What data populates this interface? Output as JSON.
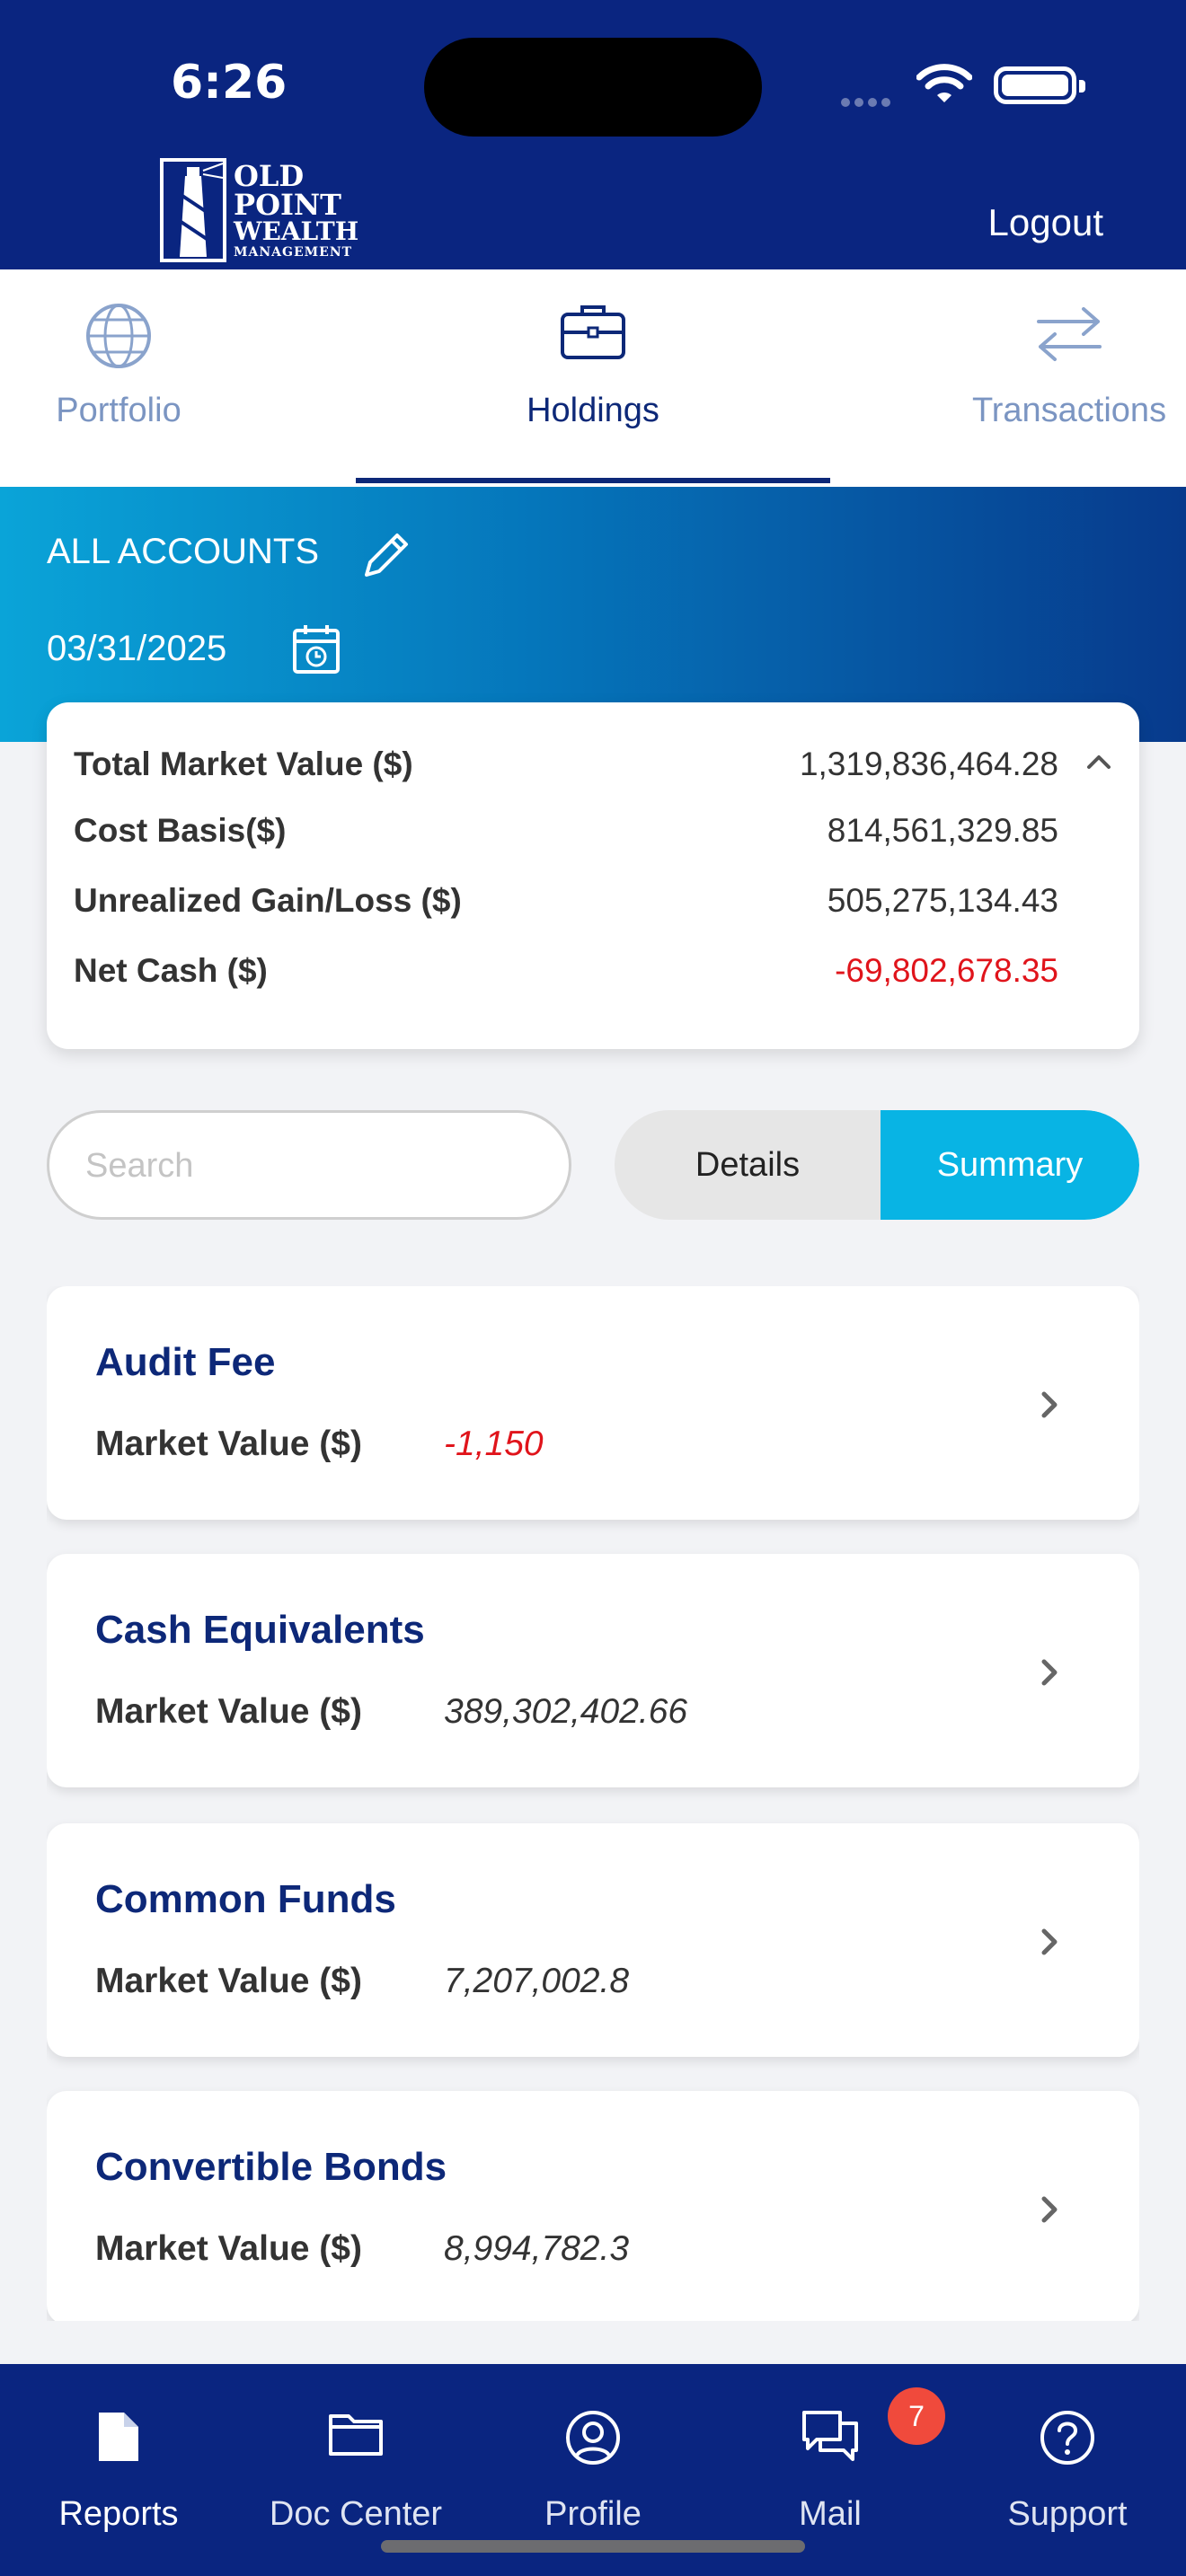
{
  "status_bar": {
    "time": "6:26"
  },
  "header": {
    "logo_lines": [
      "OLD",
      "POINT",
      "WEALTH",
      "MANAGEMENT"
    ],
    "logout_label": "Logout"
  },
  "tabs": [
    {
      "label": "Portfolio",
      "icon": "globe-icon",
      "active": false
    },
    {
      "label": "Holdings",
      "icon": "briefcase-icon",
      "active": true
    },
    {
      "label": "Transactions",
      "icon": "transfer-arrows-icon",
      "active": false
    }
  ],
  "account": {
    "name": "ALL ACCOUNTS",
    "date": "03/31/2025"
  },
  "summary": {
    "rows": [
      {
        "label": "Total Market Value ($)",
        "value": "1,319,836,464.28"
      },
      {
        "label": "Cost Basis($)",
        "value": "814,561,329.85"
      },
      {
        "label": "Unrealized Gain/Loss ($)",
        "value": "505,275,134.43"
      },
      {
        "label": "Net Cash ($)",
        "value": "-69,802,678.35"
      }
    ]
  },
  "search": {
    "placeholder": "Search",
    "value": ""
  },
  "view_toggle": {
    "details_label": "Details",
    "summary_label": "Summary",
    "selected": "Summary"
  },
  "holdings": [
    {
      "title": "Audit Fee",
      "mv_label": "Market Value ($)",
      "mv_value": "-1,150"
    },
    {
      "title": "Cash Equivalents",
      "mv_label": "Market Value ($)",
      "mv_value": "389,302,402.66"
    },
    {
      "title": "Common Funds",
      "mv_label": "Market Value ($)",
      "mv_value": "7,207,002.8"
    },
    {
      "title": "Convertible Bonds",
      "mv_label": "Market Value ($)",
      "mv_value": "8,994,782.3"
    }
  ],
  "bottom_nav": {
    "items": [
      {
        "label": "Reports",
        "icon": "document-icon",
        "active": true
      },
      {
        "label": "Doc Center",
        "icon": "folder-icon",
        "active": false
      },
      {
        "label": "Profile",
        "icon": "user-circle-icon",
        "active": false
      },
      {
        "label": "Mail",
        "icon": "chat-bubbles-icon",
        "active": false
      },
      {
        "label": "Support",
        "icon": "help-circle-icon",
        "active": false
      }
    ],
    "mail_badge": "7"
  },
  "colors": {
    "header_bg": "#0a2580",
    "accent": "#08b4e4",
    "title_blue": "#0d2878",
    "negative": "#e0141b"
  }
}
